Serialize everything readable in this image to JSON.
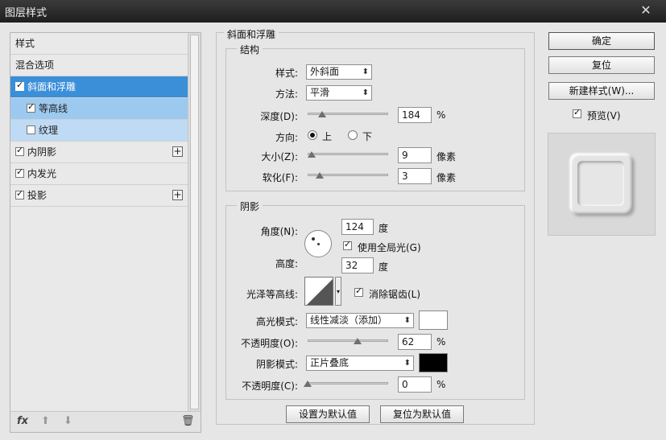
{
  "window": {
    "title": "图层样式",
    "close": "✕"
  },
  "left": {
    "items": [
      {
        "label": "样式",
        "checkbox": false,
        "plus": false
      },
      {
        "label": "混合选项",
        "checkbox": false,
        "plus": false
      },
      {
        "label": "斜面和浮雕",
        "checkbox": true,
        "checked": true,
        "plus": false,
        "state": "selected"
      },
      {
        "label": "等高线",
        "checkbox": true,
        "checked": true,
        "plus": false,
        "state": "sub"
      },
      {
        "label": "纹理",
        "checkbox": true,
        "checked": false,
        "plus": false,
        "state": "sub"
      },
      {
        "label": "内阴影",
        "checkbox": true,
        "checked": true,
        "plus": true
      },
      {
        "label": "内发光",
        "checkbox": true,
        "checked": true,
        "plus": false
      },
      {
        "label": "投影",
        "checkbox": true,
        "checked": true,
        "plus": true
      }
    ],
    "plus_symbol": "+",
    "bottom": {
      "fx": "fx",
      "up": "⬆",
      "down": "⬇",
      "trash": "🗑"
    }
  },
  "bevel": {
    "section_title": "斜面和浮雕",
    "structure": {
      "title": "结构",
      "style_label": "样式:",
      "style_value": "外斜面",
      "method_label": "方法:",
      "method_value": "平滑",
      "depth_label": "深度(D):",
      "depth_value": "184",
      "depth_unit": "%",
      "depth_slider": 0.18,
      "direction_label": "方向:",
      "dir_up": "上",
      "dir_down": "下",
      "size_label": "大小(Z):",
      "size_value": "9",
      "size_unit": "像素",
      "size_slider": 0.05,
      "soften_label": "软化(F):",
      "soften_value": "3",
      "soften_unit": "像素",
      "soften_slider": 0.15
    },
    "shading": {
      "title": "阴影",
      "angle_label": "角度(N):",
      "angle_value": "124",
      "angle_unit": "度",
      "global_light": "使用全局光(G)",
      "altitude_label": "高度:",
      "altitude_value": "32",
      "altitude_unit": "度",
      "gloss_label": "光泽等高线:",
      "antialias": "消除锯齿(L)",
      "highlight_label": "高光模式:",
      "highlight_value": "线性减淡（添加）",
      "highlight_color": "#ffffff",
      "opacity1_label": "不透明度(O):",
      "opacity1_value": "62",
      "opacity1_unit": "%",
      "opacity1_slider": 0.62,
      "shadow_label": "阴影模式:",
      "shadow_value": "正片叠底",
      "shadow_color": "#000000",
      "opacity2_label": "不透明度(C):",
      "opacity2_value": "0",
      "opacity2_unit": "%",
      "opacity2_slider": 0.0
    },
    "set_default": "设置为默认值",
    "reset_default": "复位为默认值"
  },
  "right": {
    "ok": "确定",
    "reset": "复位",
    "new_style": "新建样式(W)...",
    "preview": "预览(V)"
  }
}
